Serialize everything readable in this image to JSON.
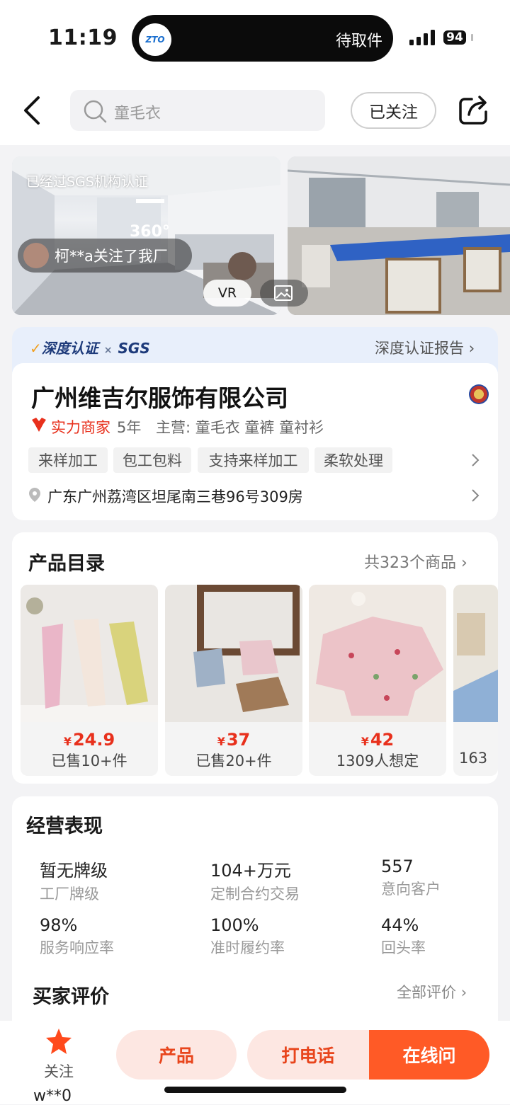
{
  "status_bar": {
    "time": "11:19",
    "app_name": "中通快递",
    "app_logo_text": "ZTO",
    "live_activity": "待取件",
    "battery": "94"
  },
  "nav": {
    "search_placeholder": "童毛衣",
    "follow_label": "已关注"
  },
  "gallery": {
    "cert_label": "已经过SGS机构认证",
    "view_360": "360°",
    "follow_notice": "柯**a关注了我厂",
    "vr_label": "VR"
  },
  "certification": {
    "brand": "深度认证",
    "partner": "SGS",
    "separator": "×",
    "report_link": "深度认证报告"
  },
  "company": {
    "name": "广州维吉尔服饰有限公司",
    "merchant_tag": "实力商家",
    "years": "5年",
    "main_business": "主营: 童毛衣 童裤 童衬衫",
    "tags": [
      "来样加工",
      "包工包料",
      "支持来样加工",
      "柔软处理"
    ],
    "address": "广东广州荔湾区坦尾南三巷96号309房"
  },
  "catalog": {
    "title": "产品目录",
    "count_label": "共323个商品",
    "products": [
      {
        "price": "24.9",
        "sold": "已售10+件"
      },
      {
        "price": "37",
        "sold": "已售20+件"
      },
      {
        "price": "42",
        "sold": "1309人想定"
      },
      {
        "price": "",
        "sold": "163"
      }
    ],
    "currency": "¥"
  },
  "performance": {
    "title": "经营表现",
    "stats": [
      {
        "value": "暂无牌级",
        "label": "工厂牌级"
      },
      {
        "value": "104+万元",
        "label": "定制合约交易"
      },
      {
        "value": "557",
        "label": "意向客户"
      },
      {
        "value": "98%",
        "label": "服务响应率"
      },
      {
        "value": "100%",
        "label": "准时履约率"
      },
      {
        "value": "44%",
        "label": "回头率"
      }
    ]
  },
  "reviews": {
    "title": "买家评价",
    "all_link": "全部评价"
  },
  "bottom": {
    "follow_label": "关注",
    "user": "w**0",
    "products_btn": "产品",
    "call_btn": "打电话",
    "chat_btn": "在线问"
  },
  "colors": {
    "accent": "#ff5a26",
    "price": "#e8301c",
    "soft": "#fde7e2",
    "cert_band": "#e8effb"
  }
}
